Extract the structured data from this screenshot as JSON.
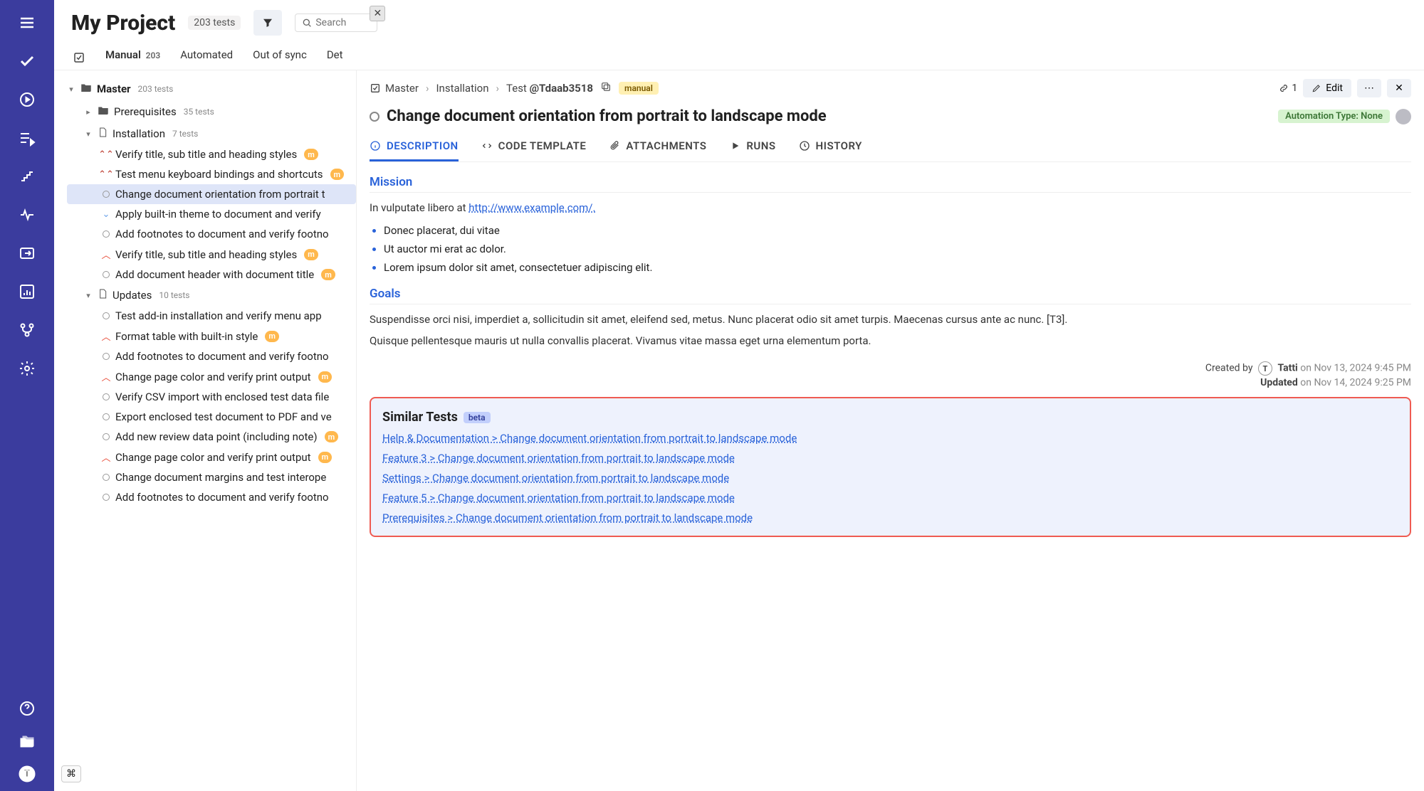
{
  "project": {
    "title": "My Project",
    "tests_count": "203 tests"
  },
  "search": {
    "placeholder": "Search"
  },
  "categories": [
    {
      "label": "Manual",
      "count": "203"
    },
    {
      "label": "Automated"
    },
    {
      "label": "Out of sync"
    },
    {
      "label": "Det"
    }
  ],
  "tree": {
    "master": {
      "label": "Master",
      "count": "203 tests"
    },
    "prereq": {
      "label": "Prerequisites",
      "count": "35 tests"
    },
    "install": {
      "label": "Installation",
      "count": "7 tests"
    },
    "install_items": [
      {
        "t": "Verify title, sub title and heading styles",
        "p": "rdk",
        "m": true
      },
      {
        "t": "Test menu keyboard bindings and shortcuts",
        "p": "rdk",
        "m": true
      },
      {
        "t": "Change document orientation from portrait t",
        "p": "none",
        "sel": true
      },
      {
        "t": "Apply built-in theme to document and verify",
        "p": "lbl"
      },
      {
        "t": "Add footnotes to document and verify footno",
        "p": "none"
      },
      {
        "t": "Verify title, sub title and heading styles",
        "p": "red",
        "m": true
      },
      {
        "t": "Add document header with document title",
        "p": "none",
        "m": true
      }
    ],
    "updates": {
      "label": "Updates",
      "count": "10 tests"
    },
    "updates_items": [
      {
        "t": "Test add-in installation and verify menu app",
        "p": "none"
      },
      {
        "t": "Format table with built-in style",
        "p": "red",
        "m": true
      },
      {
        "t": "Add footnotes to document and verify footno",
        "p": "none"
      },
      {
        "t": "Change page color and verify print output",
        "p": "red",
        "m": true
      },
      {
        "t": "Verify CSV import with enclosed test data file",
        "p": "none"
      },
      {
        "t": "Export enclosed test document to PDF and ve",
        "p": "none"
      },
      {
        "t": "Add new review data point (including note)",
        "p": "none",
        "m": true
      },
      {
        "t": "Change page color and verify print output",
        "p": "red",
        "m": true
      },
      {
        "t": "Change document margins and test interope",
        "p": "none"
      },
      {
        "t": "Add footnotes to document and verify footno",
        "p": "none"
      }
    ]
  },
  "detail": {
    "breadcrumb": {
      "a": "Master",
      "b": "Installation",
      "c": "Test",
      "id": "@Tdaab3518"
    },
    "manual_chip": "manual",
    "link_count": "1",
    "edit": "Edit",
    "title": "Change document orientation from portrait to landscape mode",
    "automation": "Automation Type: None",
    "tabs": {
      "desc": "DESCRIPTION",
      "code": "CODE TEMPLATE",
      "att": "ATTACHMENTS",
      "runs": "RUNS",
      "hist": "HISTORY"
    },
    "mission_title": "Mission",
    "mission_lead": "In vulputate libero at ",
    "mission_link": "http://www.example.com/.",
    "bullets": [
      "Donec placerat, dui vitae",
      "Ut auctor mi erat ac dolor.",
      "Lorem ipsum dolor sit amet, consectetuer adipiscing elit."
    ],
    "goals_title": "Goals",
    "goals_p1": "Suspendisse orci nisi, imperdiet a, sollicitudin sit amet, eleifend sed, metus. Nunc placerat odio sit amet turpis. Maecenas cursus ante ac nunc. [T3].",
    "goals_p2": "Quisque pellentesque mauris ut nulla convallis placerat. Vivamus vitae massa eget urna elementum porta.",
    "created_label": "Created by",
    "created_who": "Tatti",
    "created_date": "on Nov 13, 2024 9:45 PM",
    "updated_label": "Updated",
    "updated_date": "on Nov 14, 2024 9:25 PM",
    "similar_title": "Similar Tests",
    "beta": "beta",
    "similar_items": [
      "Help & Documentation > Change document orientation from portrait to landscape mode",
      "Feature 3 > Change document orientation from portrait to landscape mode",
      "Settings > Change document orientation from portrait to landscape mode",
      "Feature 5 > Change document orientation from portrait to landscape mode",
      "Prerequisites > Change document orientation from portrait to landscape mode"
    ]
  },
  "m_chip": "m",
  "avatar_initial": "T",
  "cmd": "⌘"
}
